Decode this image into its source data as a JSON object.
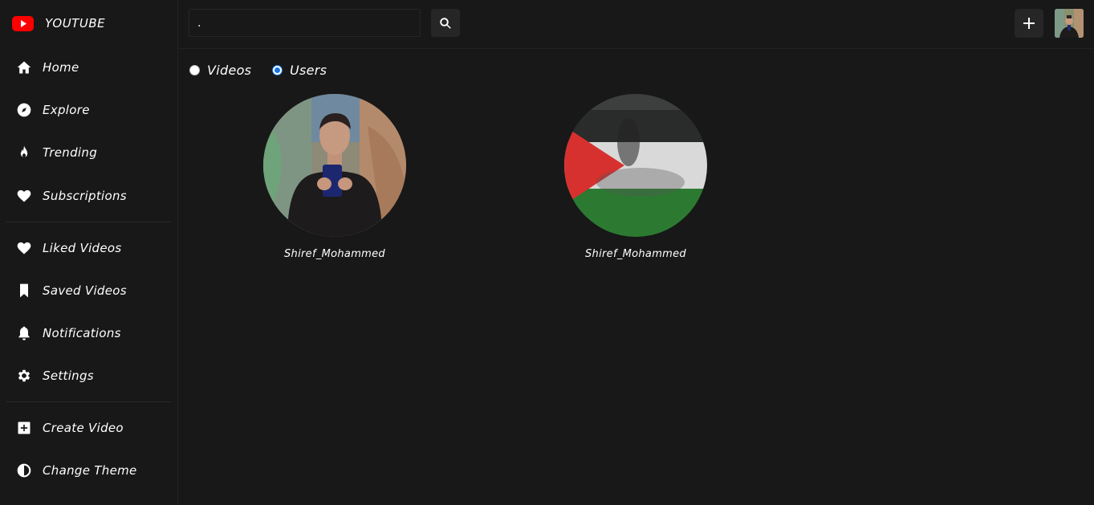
{
  "app": {
    "title": "YOUTUBE"
  },
  "sidebar": {
    "items": [
      {
        "label": "Home",
        "icon": "home-icon"
      },
      {
        "label": "Explore",
        "icon": "compass-icon"
      },
      {
        "label": "Trending",
        "icon": "fire-icon"
      },
      {
        "label": "Subscriptions",
        "icon": "heart-icon"
      },
      {
        "label": "Liked Videos",
        "icon": "heart-icon"
      },
      {
        "label": "Saved Videos",
        "icon": "bookmark-icon"
      },
      {
        "label": "Notifications",
        "icon": "bell-icon"
      },
      {
        "label": "Settings",
        "icon": "gear-icon"
      },
      {
        "label": "Create Video",
        "icon": "plus-square-icon"
      },
      {
        "label": "Change Theme",
        "icon": "half-circle-icon"
      }
    ]
  },
  "header": {
    "search_value": ".",
    "search_icon": "search-icon",
    "add_icon": "plus-icon"
  },
  "filter": {
    "options": [
      {
        "label": "Videos",
        "checked": false
      },
      {
        "label": "Users",
        "checked": true
      }
    ]
  },
  "results": {
    "users": [
      {
        "name": "Shiref_Mohammed",
        "avatar": "user-photo"
      },
      {
        "name": "Shiref_Mohammed",
        "avatar": "palestine-flag"
      }
    ]
  },
  "colors": {
    "background": "#181818",
    "accent": "#1a73e8",
    "logo_red": "#ff0000"
  }
}
